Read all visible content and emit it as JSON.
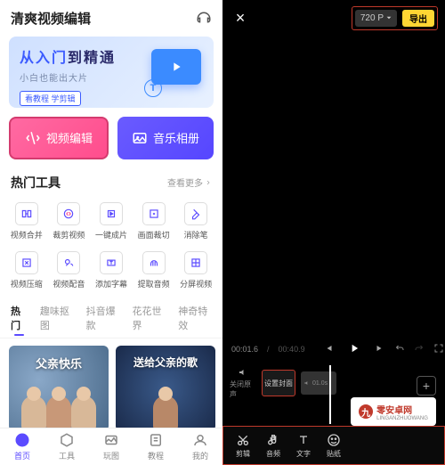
{
  "header": {
    "title": "清爽视频编辑"
  },
  "banner": {
    "title_part1": "从入门",
    "title_part2": "到精通",
    "subtitle": "小白也能出大片",
    "chip": "看教程 学剪辑"
  },
  "actions": {
    "edit": "视频编辑",
    "album": "音乐相册"
  },
  "tools_section": {
    "title": "热门工具",
    "more": "查看更多"
  },
  "tools": [
    {
      "label": "视频合并"
    },
    {
      "label": "裁剪视频"
    },
    {
      "label": "一键成片"
    },
    {
      "label": "画面裁切"
    },
    {
      "label": "消除笔"
    },
    {
      "label": "视频压缩"
    },
    {
      "label": "视频配音"
    },
    {
      "label": "添加字幕"
    },
    {
      "label": "提取音频"
    },
    {
      "label": "分屏视频"
    }
  ],
  "tabs": [
    "热门",
    "趣味抠图",
    "抖音爆款",
    "花花世界",
    "神奇特效"
  ],
  "cards": [
    {
      "title": "父亲快乐"
    },
    {
      "title": "送给父亲的歌"
    }
  ],
  "nav": [
    {
      "label": "首页"
    },
    {
      "label": "工具"
    },
    {
      "label": "玩图"
    },
    {
      "label": "教程"
    },
    {
      "label": "我的"
    }
  ],
  "editor": {
    "resolution": "720 P",
    "export": "导出",
    "time_current": "00:01.6",
    "time_total": "00:40.9",
    "audio_label": "关闭原声",
    "cover_label": "设置封面",
    "clip_duration": "01.0s",
    "add": "+",
    "bottom": [
      {
        "label": "剪辑"
      },
      {
        "label": "音频"
      },
      {
        "label": "文字"
      },
      {
        "label": "贴纸"
      }
    ]
  },
  "watermark": {
    "text": "零安卓网",
    "sub": "LINGANZHUOWANG"
  }
}
